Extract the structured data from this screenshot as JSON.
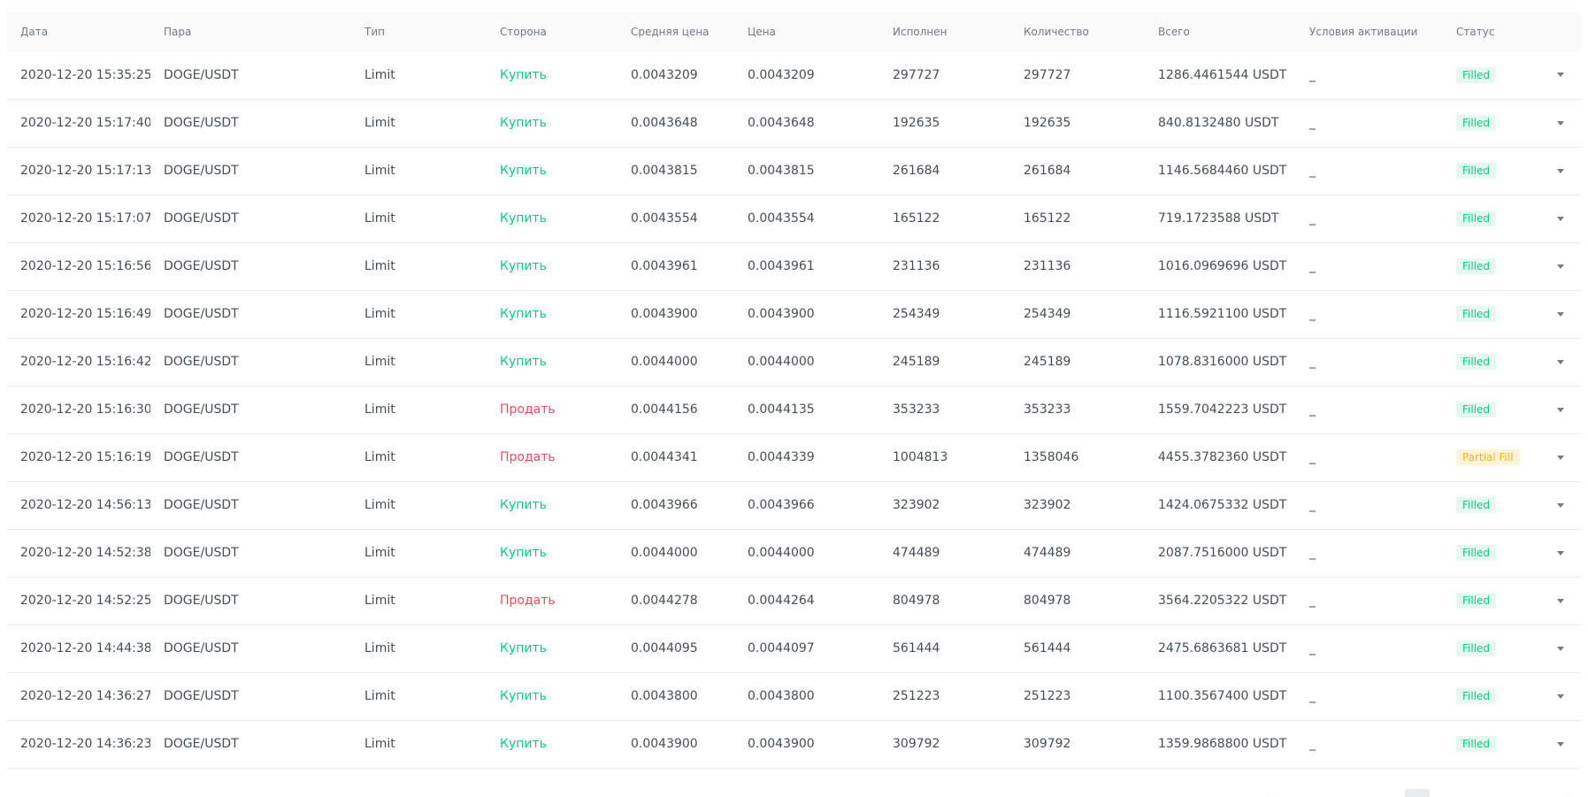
{
  "columns": {
    "date": "Дата",
    "pair": "Пара",
    "type": "Тип",
    "side": "Сторона",
    "avg_price": "Средняя цена",
    "price": "Цена",
    "executed": "Исполнен",
    "amount": "Количество",
    "total": "Всего",
    "trigger": "Условия активации",
    "status": "Статус"
  },
  "colors": {
    "buy": "#0ecb81",
    "sell": "#f6465d",
    "filled_badge_bg": "#e7f8f0",
    "partial_badge_bg": "#fdf4d8",
    "partial_badge_text": "#f0b90b"
  },
  "icons": {
    "row_expand": "chevron-down-icon"
  },
  "rows": [
    {
      "date": "2020-12-20 15:35:25",
      "pair": "DOGE/USDT",
      "type": "Limit",
      "side": "Купить",
      "side_kind": "buy",
      "avg_price": "0.0043209",
      "price": "0.0043209",
      "executed": "297727",
      "amount": "297727",
      "total": "1286.4461544 USDT",
      "trigger": "_",
      "status": "Filled",
      "status_kind": "filled"
    },
    {
      "date": "2020-12-20 15:17:40",
      "pair": "DOGE/USDT",
      "type": "Limit",
      "side": "Купить",
      "side_kind": "buy",
      "avg_price": "0.0043648",
      "price": "0.0043648",
      "executed": "192635",
      "amount": "192635",
      "total": "840.8132480 USDT",
      "trigger": "_",
      "status": "Filled",
      "status_kind": "filled"
    },
    {
      "date": "2020-12-20 15:17:13",
      "pair": "DOGE/USDT",
      "type": "Limit",
      "side": "Купить",
      "side_kind": "buy",
      "avg_price": "0.0043815",
      "price": "0.0043815",
      "executed": "261684",
      "amount": "261684",
      "total": "1146.5684460 USDT",
      "trigger": "_",
      "status": "Filled",
      "status_kind": "filled"
    },
    {
      "date": "2020-12-20 15:17:07",
      "pair": "DOGE/USDT",
      "type": "Limit",
      "side": "Купить",
      "side_kind": "buy",
      "avg_price": "0.0043554",
      "price": "0.0043554",
      "executed": "165122",
      "amount": "165122",
      "total": "719.1723588 USDT",
      "trigger": "_",
      "status": "Filled",
      "status_kind": "filled"
    },
    {
      "date": "2020-12-20 15:16:56",
      "pair": "DOGE/USDT",
      "type": "Limit",
      "side": "Купить",
      "side_kind": "buy",
      "avg_price": "0.0043961",
      "price": "0.0043961",
      "executed": "231136",
      "amount": "231136",
      "total": "1016.0969696 USDT",
      "trigger": "_",
      "status": "Filled",
      "status_kind": "filled"
    },
    {
      "date": "2020-12-20 15:16:49",
      "pair": "DOGE/USDT",
      "type": "Limit",
      "side": "Купить",
      "side_kind": "buy",
      "avg_price": "0.0043900",
      "price": "0.0043900",
      "executed": "254349",
      "amount": "254349",
      "total": "1116.5921100 USDT",
      "trigger": "_",
      "status": "Filled",
      "status_kind": "filled"
    },
    {
      "date": "2020-12-20 15:16:42",
      "pair": "DOGE/USDT",
      "type": "Limit",
      "side": "Купить",
      "side_kind": "buy",
      "avg_price": "0.0044000",
      "price": "0.0044000",
      "executed": "245189",
      "amount": "245189",
      "total": "1078.8316000 USDT",
      "trigger": "_",
      "status": "Filled",
      "status_kind": "filled"
    },
    {
      "date": "2020-12-20 15:16:30",
      "pair": "DOGE/USDT",
      "type": "Limit",
      "side": "Продать",
      "side_kind": "sell",
      "avg_price": "0.0044156",
      "price": "0.0044135",
      "executed": "353233",
      "amount": "353233",
      "total": "1559.7042223 USDT",
      "trigger": "_",
      "status": "Filled",
      "status_kind": "filled"
    },
    {
      "date": "2020-12-20 15:16:19",
      "pair": "DOGE/USDT",
      "type": "Limit",
      "side": "Продать",
      "side_kind": "sell",
      "avg_price": "0.0044341",
      "price": "0.0044339",
      "executed": "1004813",
      "amount": "1358046",
      "total": "4455.3782360 USDT",
      "trigger": "_",
      "status": "Partial Fill",
      "status_kind": "partial"
    },
    {
      "date": "2020-12-20 14:56:13",
      "pair": "DOGE/USDT",
      "type": "Limit",
      "side": "Купить",
      "side_kind": "buy",
      "avg_price": "0.0043966",
      "price": "0.0043966",
      "executed": "323902",
      "amount": "323902",
      "total": "1424.0675332 USDT",
      "trigger": "_",
      "status": "Filled",
      "status_kind": "filled"
    },
    {
      "date": "2020-12-20 14:52:38",
      "pair": "DOGE/USDT",
      "type": "Limit",
      "side": "Купить",
      "side_kind": "buy",
      "avg_price": "0.0044000",
      "price": "0.0044000",
      "executed": "474489",
      "amount": "474489",
      "total": "2087.7516000 USDT",
      "trigger": "_",
      "status": "Filled",
      "status_kind": "filled"
    },
    {
      "date": "2020-12-20 14:52:25",
      "pair": "DOGE/USDT",
      "type": "Limit",
      "side": "Продать",
      "side_kind": "sell",
      "avg_price": "0.0044278",
      "price": "0.0044264",
      "executed": "804978",
      "amount": "804978",
      "total": "3564.2205322 USDT",
      "trigger": "_",
      "status": "Filled",
      "status_kind": "filled"
    },
    {
      "date": "2020-12-20 14:44:38",
      "pair": "DOGE/USDT",
      "type": "Limit",
      "side": "Купить",
      "side_kind": "buy",
      "avg_price": "0.0044095",
      "price": "0.0044097",
      "executed": "561444",
      "amount": "561444",
      "total": "2475.6863681 USDT",
      "trigger": "_",
      "status": "Filled",
      "status_kind": "filled"
    },
    {
      "date": "2020-12-20 14:36:27",
      "pair": "DOGE/USDT",
      "type": "Limit",
      "side": "Купить",
      "side_kind": "buy",
      "avg_price": "0.0043800",
      "price": "0.0043800",
      "executed": "251223",
      "amount": "251223",
      "total": "1100.3567400 USDT",
      "trigger": "_",
      "status": "Filled",
      "status_kind": "filled"
    },
    {
      "date": "2020-12-20 14:36:23",
      "pair": "DOGE/USDT",
      "type": "Limit",
      "side": "Купить",
      "side_kind": "buy",
      "avg_price": "0.0043900",
      "price": "0.0043900",
      "executed": "309792",
      "amount": "309792",
      "total": "1359.9868800 USDT",
      "trigger": "_",
      "status": "Filled",
      "status_kind": "filled"
    }
  ],
  "pagination": {
    "prev": "‹",
    "next": "›"
  }
}
